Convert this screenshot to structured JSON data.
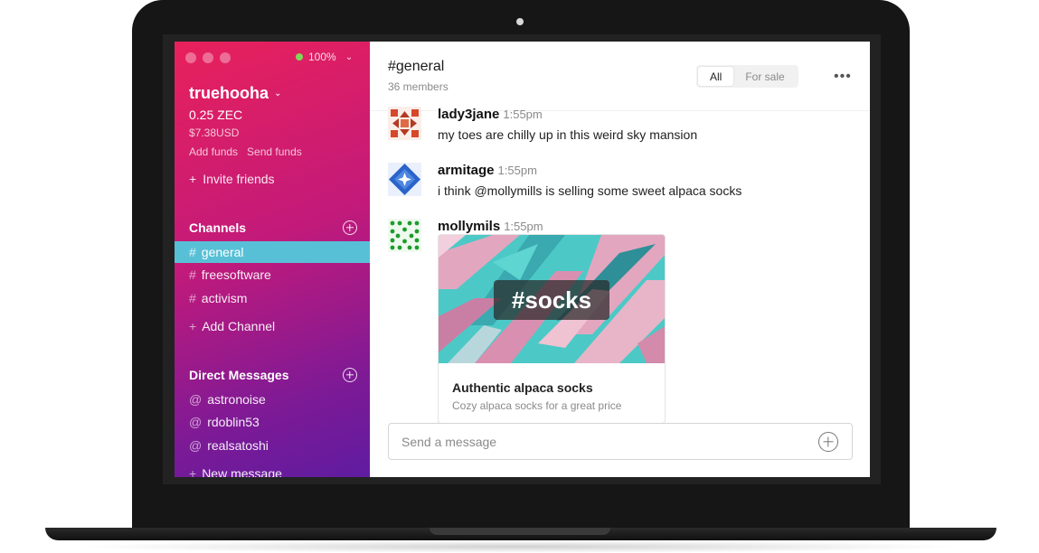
{
  "window": {
    "battery_percent": "100%"
  },
  "sidebar": {
    "wallet_name": "truehooha",
    "balance_zec": "0.25 ZEC",
    "balance_usd": "$7.38USD",
    "add_funds": "Add funds",
    "send_funds": "Send funds",
    "invite_friends": "Invite friends",
    "channels_heading": "Channels",
    "channels": [
      {
        "label": "general",
        "active": true
      },
      {
        "label": "freesoftware",
        "active": false
      },
      {
        "label": "activism",
        "active": false
      }
    ],
    "add_channel": "Add Channel",
    "dm_heading": "Direct Messages",
    "direct_messages": [
      {
        "label": "astronoise"
      },
      {
        "label": "rdoblin53"
      },
      {
        "label": "realsatoshi"
      }
    ],
    "new_message": "New message",
    "channel_prefix": "#",
    "dm_prefix": "@",
    "plus_glyph": "+"
  },
  "header": {
    "channel_title": "#general",
    "member_count": "36 members",
    "filters": [
      {
        "label": "All",
        "selected": true
      },
      {
        "label": "For sale",
        "selected": false
      }
    ],
    "more_glyph": "•••"
  },
  "messages": [
    {
      "author": "lady3jane",
      "time": "1:55pm",
      "text": "my toes are chilly up in this weird sky mansion",
      "avatar": "red-geometric-avatar"
    },
    {
      "author": "armitage",
      "time": "1:55pm",
      "text": "i think @mollymills is selling some sweet alpaca socks",
      "avatar": "blue-diamond-avatar"
    },
    {
      "author": "mollymils",
      "time": "1:55pm",
      "text": "",
      "avatar": "green-dots-avatar"
    }
  ],
  "listing_card": {
    "tag": "#socks",
    "title": "Authentic alpaca socks",
    "description": "Cozy alpaca socks for a great price"
  },
  "composer": {
    "placeholder": "Send a message"
  },
  "colors": {
    "sidebar_top": "#e8215b",
    "sidebar_bottom": "#5f1ca0",
    "active_channel": "#58c0d6"
  }
}
